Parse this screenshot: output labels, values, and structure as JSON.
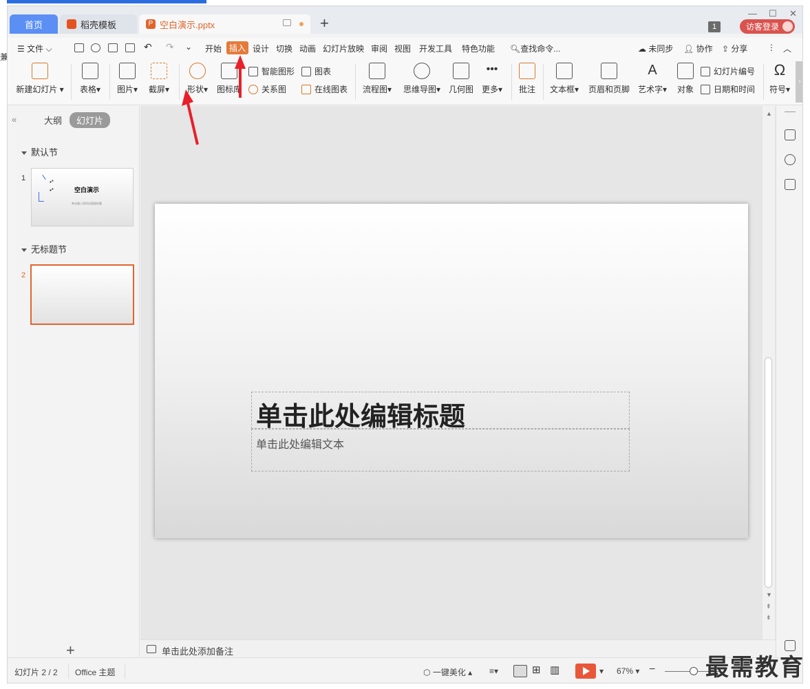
{
  "tabs": {
    "home": "首页",
    "templates": "稻壳模板",
    "document": "空白演示.pptx"
  },
  "window": {
    "page_badge": "1",
    "visitor_login": "访客登录"
  },
  "menu": {
    "file": "文件",
    "items": [
      "开始",
      "插入",
      "设计",
      "切换",
      "动画",
      "幻灯片放映",
      "审阅",
      "视图",
      "开发工具",
      "特色功能"
    ],
    "active": "插入",
    "search": "查找命令...",
    "unsynced": "未同步",
    "collaborate": "协作",
    "share": "分享"
  },
  "ribbon": {
    "new_slide": "新建幻灯片",
    "table": "表格",
    "picture": "图片",
    "screenshot": "截屏",
    "shape": "形状",
    "icon_library": "图标库",
    "smart_graphic": "智能图形",
    "chart": "图表",
    "relation_chart": "关系图",
    "online_chart": "在线图表",
    "flowchart": "流程图",
    "mind_map": "思维导图",
    "geometry": "几何图",
    "more": "更多",
    "comment": "批注",
    "text_box": "文本框",
    "header_footer": "页眉和页脚",
    "word_art": "艺术字",
    "object": "对象",
    "slide_number": "幻灯片编号",
    "date_time": "日期和时间",
    "symbol": "符号"
  },
  "left_pane": {
    "outline_tab": "大纲",
    "slides_tab": "幻灯片",
    "section1": "默认节",
    "section2": "无标题节",
    "slide1_number": "1",
    "slide2_number": "2",
    "thumb1_title": "空白演示",
    "thumb1_sub": "单击输入您的封面副标题",
    "thumb1_bullets": "•*\n•*"
  },
  "slide": {
    "title_placeholder": "单击此处编辑标题",
    "subtitle_placeholder": "单击此处编辑文本"
  },
  "notes": {
    "placeholder": "单击此处添加备注"
  },
  "status": {
    "slide_counter": "幻灯片 2 / 2",
    "theme": "Office 主题",
    "beautify": "一键美化",
    "zoom": "67%"
  },
  "watermark": "最需教育",
  "colors": {
    "accent": "#e0652d",
    "home_tab": "#5b8ff4",
    "visitor_badge": "#d9534f",
    "annotation_arrow": "#e8202a"
  }
}
